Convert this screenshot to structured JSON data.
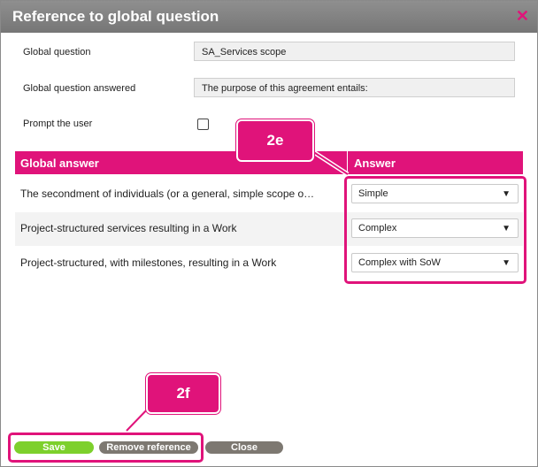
{
  "dialog": {
    "title": "Reference to global question",
    "close_icon": "close-icon"
  },
  "form": {
    "global_question_label": "Global question",
    "global_question_value": "SA_Services scope",
    "global_question_answered_label": "Global question answered",
    "global_question_answered_value": "The purpose of this agreement entails:",
    "prompt_user_label": "Prompt the user",
    "prompt_user_checked": false
  },
  "table": {
    "headers": [
      "Global answer",
      "Answer"
    ],
    "rows": [
      {
        "global_answer": "The secondment of individuals (or a general, simple scope o…",
        "answer": "Simple"
      },
      {
        "global_answer": "Project-structured services resulting in a Work",
        "answer": "Complex"
      },
      {
        "global_answer": "Project-structured, with milestones, resulting in a Work",
        "answer": "Complex with SoW"
      }
    ]
  },
  "annotations": {
    "callout_answers": "2e",
    "callout_buttons": "2f"
  },
  "buttons": {
    "save": "Save",
    "remove_reference": "Remove reference",
    "close": "Close"
  },
  "colors": {
    "accent": "#e0137a",
    "titlebar": "#7f7f7f",
    "save_button": "#7dd02c",
    "neutral_button": "#7d7871"
  }
}
